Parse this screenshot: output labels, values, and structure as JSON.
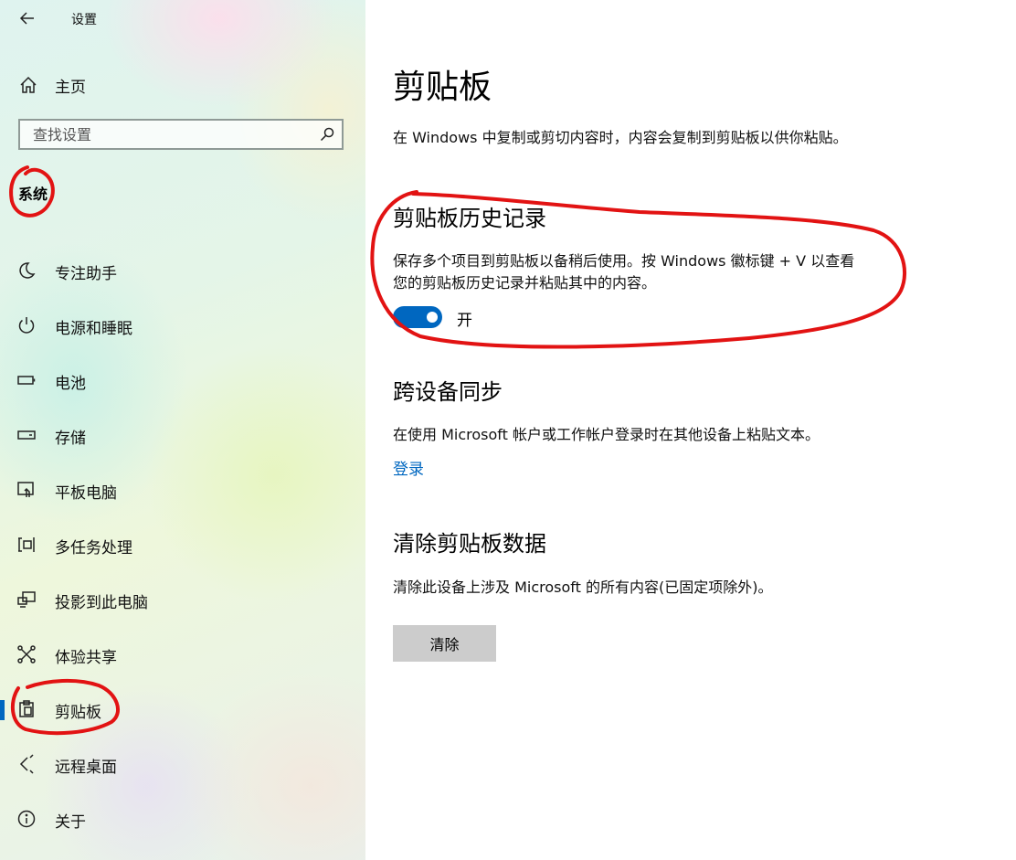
{
  "window": {
    "title": "设置"
  },
  "sidebar": {
    "home_label": "主页",
    "search_placeholder": "查找设置",
    "section_title": "系统",
    "items": [
      {
        "label": "专注助手",
        "icon": "moon-icon"
      },
      {
        "label": "电源和睡眠",
        "icon": "power-icon"
      },
      {
        "label": "电池",
        "icon": "battery-icon"
      },
      {
        "label": "存储",
        "icon": "storage-icon"
      },
      {
        "label": "平板电脑",
        "icon": "tablet-icon"
      },
      {
        "label": "多任务处理",
        "icon": "multitasking-icon"
      },
      {
        "label": "投影到此电脑",
        "icon": "project-icon"
      },
      {
        "label": "体验共享",
        "icon": "share-icon"
      },
      {
        "label": "剪贴板",
        "icon": "clipboard-icon",
        "active": true
      },
      {
        "label": "远程桌面",
        "icon": "remote-desktop-icon"
      },
      {
        "label": "关于",
        "icon": "info-icon"
      }
    ]
  },
  "main": {
    "title": "剪贴板",
    "intro": "在 Windows 中复制或剪切内容时，内容会复制到剪贴板以供你粘贴。",
    "history": {
      "heading": "剪贴板历史记录",
      "desc_line1": "保存多个项目到剪贴板以备稍后使用。按 Windows 徽标键 + V 以查看",
      "desc_line2": "您的剪贴板历史记录并粘贴其中的内容。",
      "toggle_state": "开",
      "toggle_on": true
    },
    "sync": {
      "heading": "跨设备同步",
      "desc": "在使用 Microsoft 帐户或工作帐户登录时在其他设备上粘贴文本。",
      "link": "登录"
    },
    "clear": {
      "heading": "清除剪贴板数据",
      "desc": "清除此设备上涉及 Microsoft 的所有内容(已固定项除外)。",
      "button": "清除"
    }
  },
  "colors": {
    "accent": "#0067c0",
    "annotation": "#e21313",
    "button_bg": "#cccccc"
  }
}
